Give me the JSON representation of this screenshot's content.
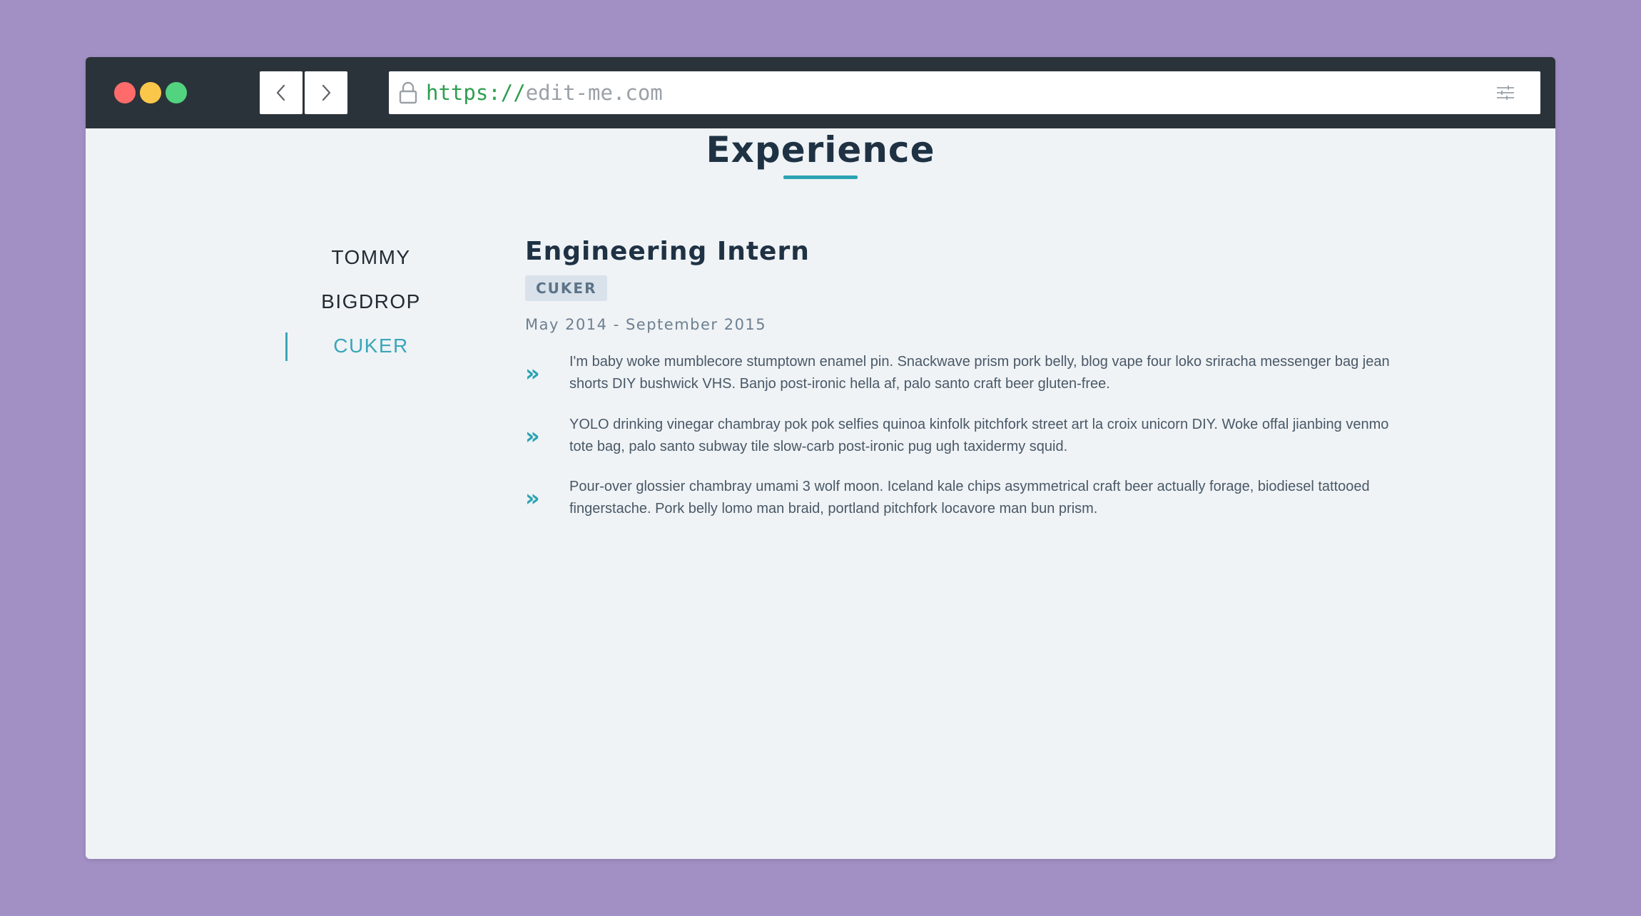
{
  "browser": {
    "url_scheme": "https://",
    "url_host": "edit-me.com"
  },
  "section": {
    "title": "Experience"
  },
  "tabs": [
    {
      "label": "TOMMY",
      "active": false
    },
    {
      "label": "BIGDROP",
      "active": false
    },
    {
      "label": "CUKER",
      "active": true
    }
  ],
  "job": {
    "title": "Engineering Intern",
    "company": "CUKER",
    "dates": "May 2014 - September 2015",
    "bullet_glyph": "»",
    "bullets": [
      "I'm baby woke mumblecore stumptown enamel pin. Snackwave prism pork belly, blog vape four loko sriracha messenger bag jean shorts DIY bushwick VHS. Banjo post-ironic hella af, palo santo craft beer gluten-free.",
      "YOLO drinking vinegar chambray pok pok selfies quinoa kinfolk pitchfork street art la croix unicorn DIY. Woke offal jianbing venmo tote bag, palo santo subway tile slow-carb post-ironic pug ugh taxidermy squid.",
      "Pour-over glossier chambray umami 3 wolf moon. Iceland kale chips asymmetrical craft beer actually forage, biodiesel tattooed fingerstache. Pork belly lomo man braid, portland pitchfork locavore man bun prism."
    ]
  },
  "colors": {
    "page_bg": "#a290c4",
    "titlebar": "#2b333a",
    "accent": "#3aa6b9",
    "heading": "#1f3244"
  }
}
